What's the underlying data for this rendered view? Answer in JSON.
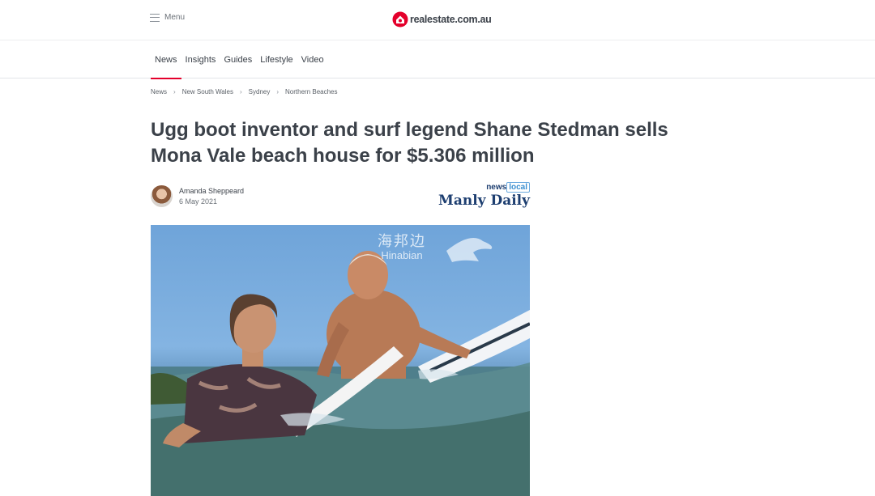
{
  "header": {
    "menu_label": "Menu",
    "logo_text": "realestate.com.au"
  },
  "nav": {
    "items": [
      {
        "label": "News",
        "active": true
      },
      {
        "label": "Insights",
        "active": false
      },
      {
        "label": "Guides",
        "active": false
      },
      {
        "label": "Lifestyle",
        "active": false
      },
      {
        "label": "Video",
        "active": false
      }
    ]
  },
  "breadcrumb": [
    "News",
    "New South Wales",
    "Sydney",
    "Northern Beaches"
  ],
  "article": {
    "headline": "Ugg boot inventor and surf legend Shane Stedman sells Mona Vale beach house for $5.306 million",
    "author": "Amanda Sheppeard",
    "date": "6 May 2021",
    "publication_top": "news",
    "publication_local": "local",
    "publication_name": "Manly Daily"
  },
  "watermark": {
    "cn": "海邦边",
    "en": "Hinabian"
  },
  "colors": {
    "accent": "#e4002b",
    "text": "#3b4149",
    "pub_navy": "#1d3e70"
  }
}
